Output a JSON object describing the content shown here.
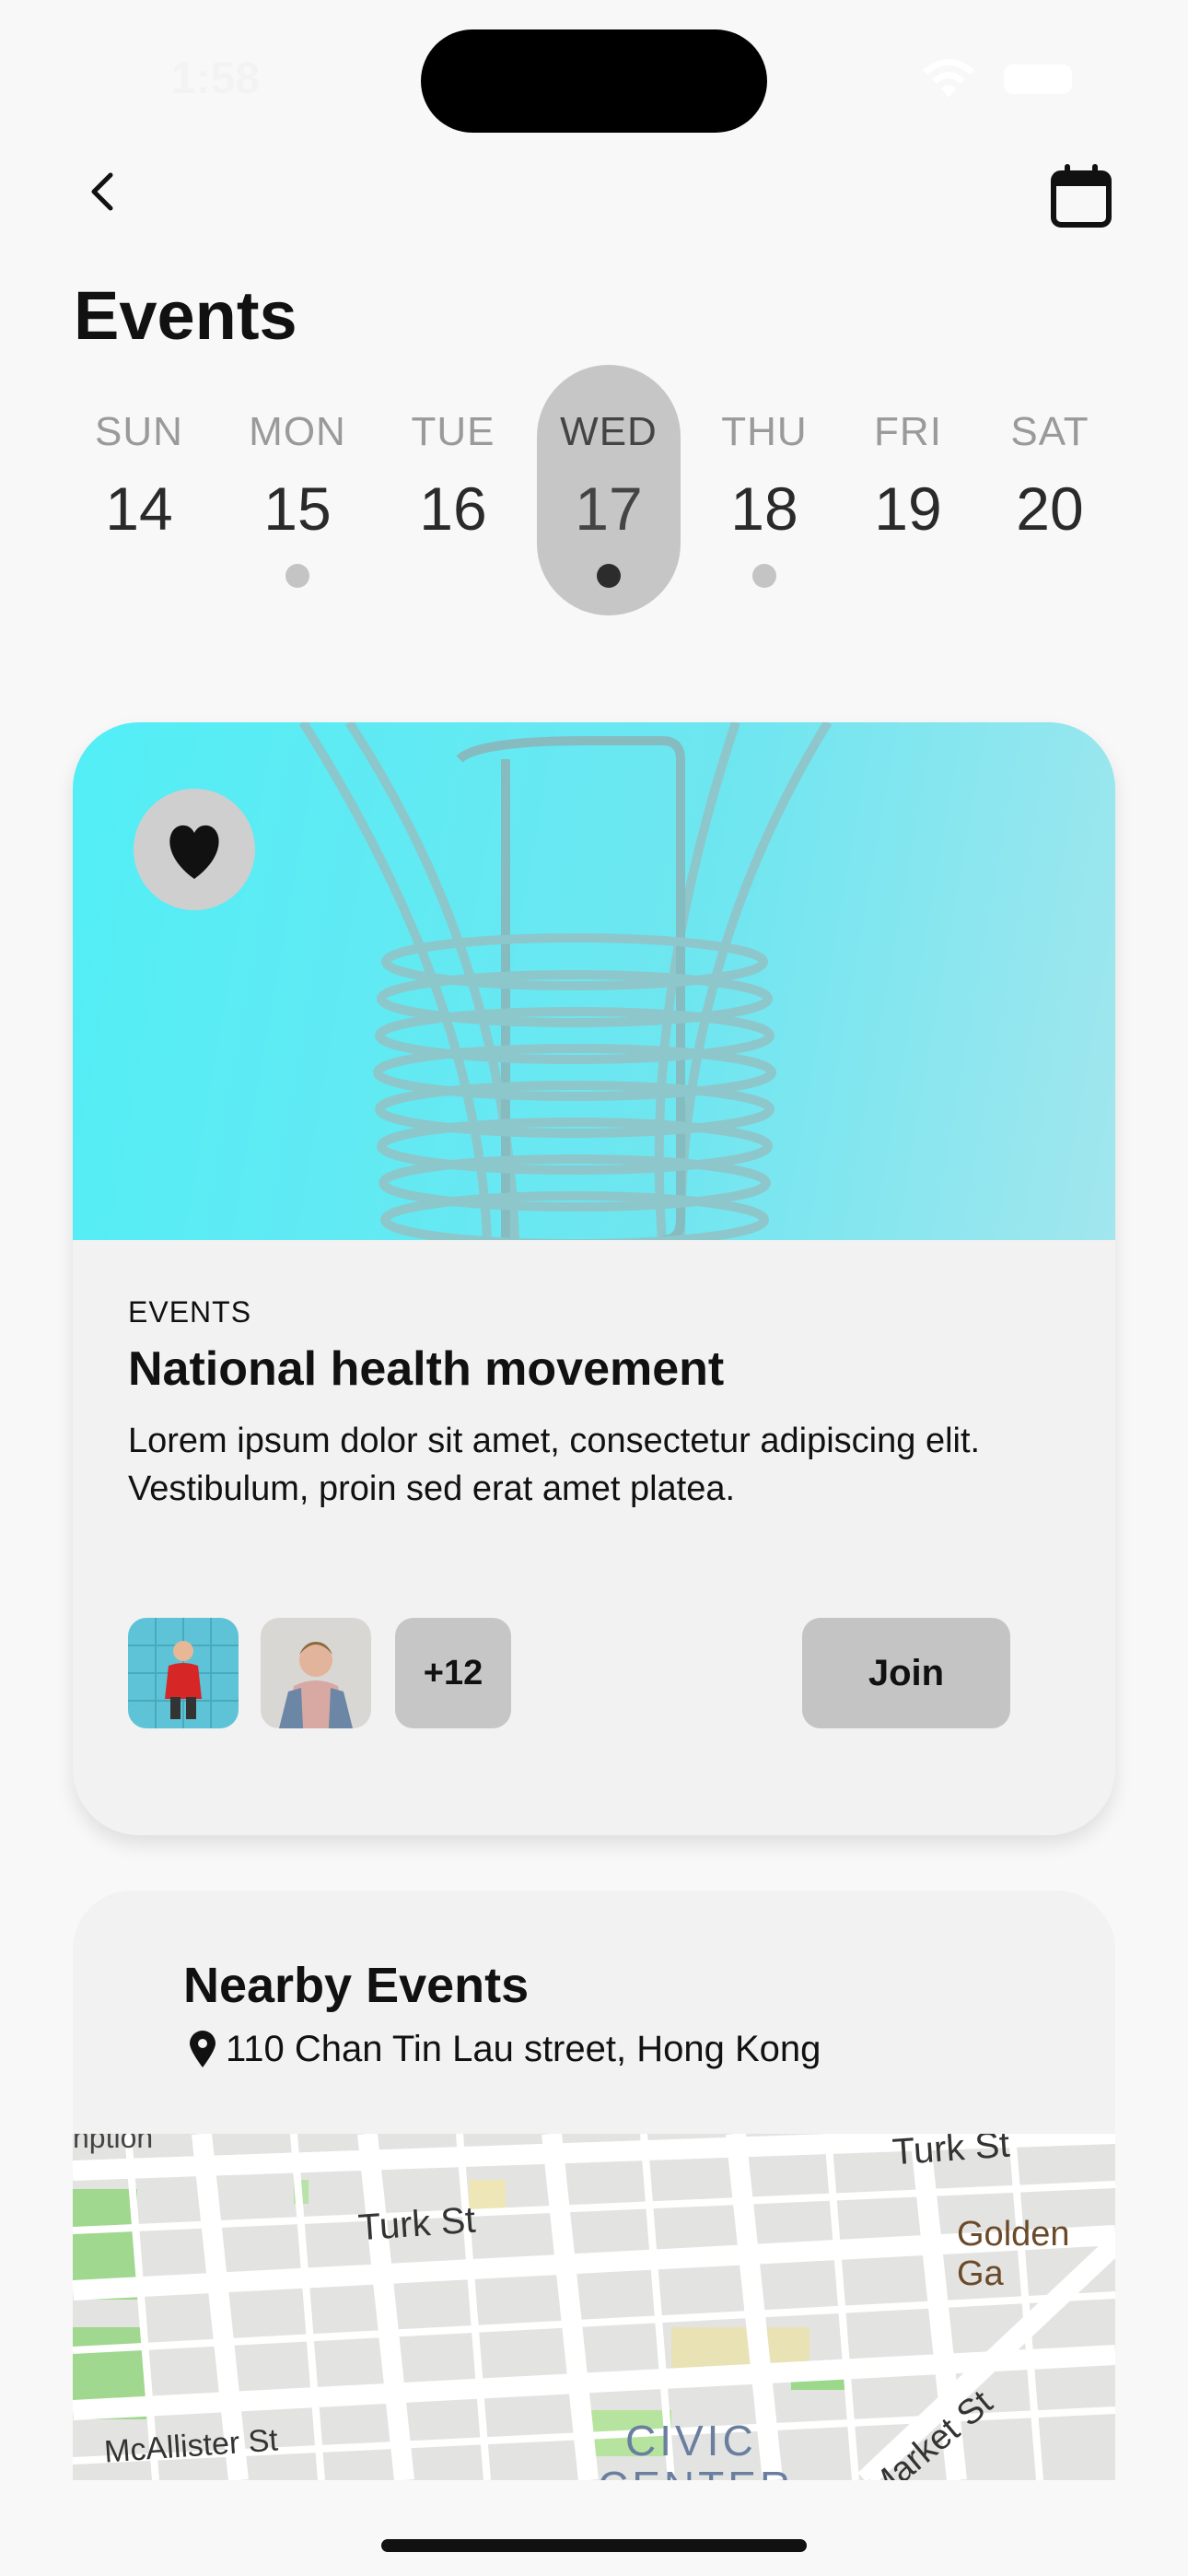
{
  "status_bar": {
    "time": "1:58"
  },
  "header": {
    "title": "Events"
  },
  "week": {
    "days": [
      {
        "name": "SUN",
        "num": "14",
        "has_event": false,
        "selected": false
      },
      {
        "name": "MON",
        "num": "15",
        "has_event": true,
        "selected": false
      },
      {
        "name": "TUE",
        "num": "16",
        "has_event": false,
        "selected": false
      },
      {
        "name": "WED",
        "num": "17",
        "has_event": true,
        "selected": true
      },
      {
        "name": "THU",
        "num": "18",
        "has_event": true,
        "selected": false
      },
      {
        "name": "FRI",
        "num": "19",
        "has_event": false,
        "selected": false
      },
      {
        "name": "SAT",
        "num": "20",
        "has_event": false,
        "selected": false
      }
    ]
  },
  "event_card": {
    "category": "EVENTS",
    "title": "National health movement",
    "description": "Lorem ipsum dolor sit amet, consectetur adipiscing elit. Vestibulum, proin sed erat amet platea.",
    "attendees_more": "+12",
    "join_label": "Join",
    "favorite": true
  },
  "nearby": {
    "title": "Nearby Events",
    "address": "110 Chan Tin Lau street, Hong Kong",
    "map_labels": [
      "nption",
      "Turk St",
      "Turk St",
      "Golden Ga",
      "McAllister St",
      "CIVIC",
      "CENTER",
      "Market St"
    ]
  },
  "colors": {
    "background": "#f8f8f8",
    "card": "#f2f2f2",
    "selected_day": "#c6c6c6",
    "hero": "#52eef6"
  }
}
